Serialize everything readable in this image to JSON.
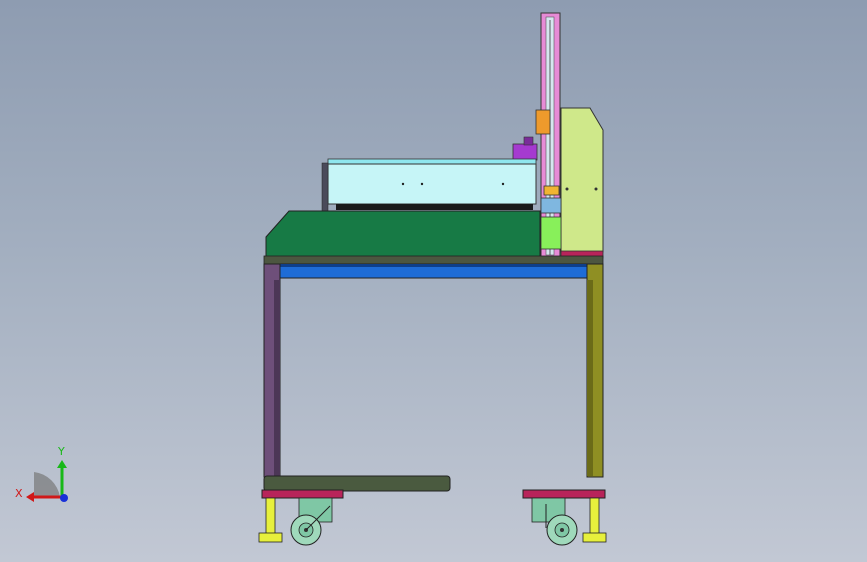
{
  "viewport": {
    "background_top": "#8e9cb1",
    "background_bottom": "#c2c8d4"
  },
  "triad": {
    "x_label": "X",
    "y_label": "Y",
    "x_color": "#d01818",
    "y_color": "#18b818",
    "z_color": "#1830d8"
  },
  "model": {
    "tabletop_color": "#177a45",
    "rail_color": "#1e6cd6",
    "hood_color": "#c6f5f7",
    "left_leg_color": "#6e4f7a",
    "right_leg_color": "#8f8f23",
    "side_panel_color": "#cfe88a",
    "column_color": "#e78bd6",
    "caster_color": "#7fc7a5",
    "foot_color": "#e7f03c",
    "mount_plate_color": "#b8245a"
  }
}
